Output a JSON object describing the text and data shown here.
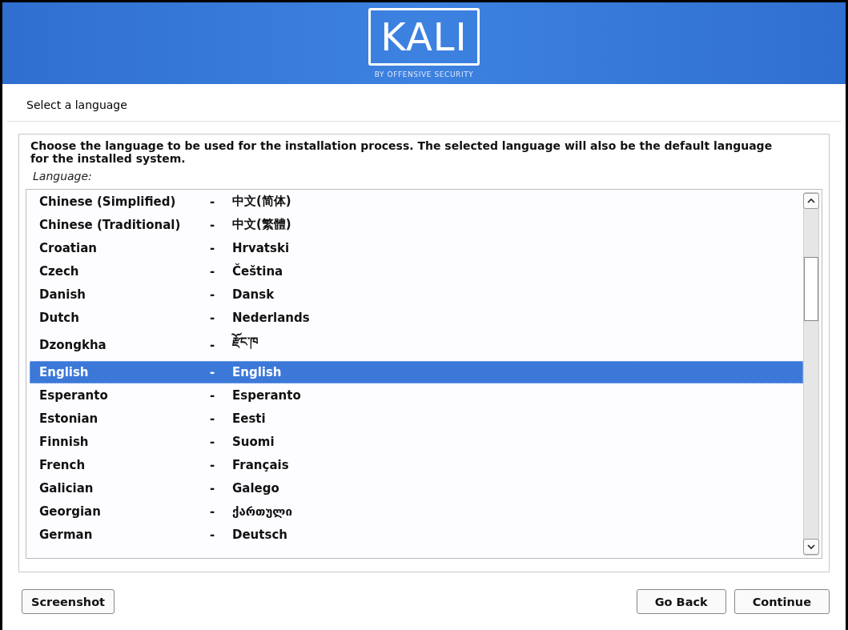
{
  "header": {
    "logo_text": "KALI",
    "logo_tagline": "BY OFFENSIVE SECURITY"
  },
  "page_title": "Select a language",
  "description": "Choose the language to be used for the installation process. The selected language will also be the default language for the installed system.",
  "list_label": "Language:",
  "languages": [
    {
      "name": "Chinese (Simplified)",
      "separator": "-",
      "native": "中文(简体)",
      "selected": false
    },
    {
      "name": "Chinese (Traditional)",
      "separator": "-",
      "native": "中文(繁體)",
      "selected": false
    },
    {
      "name": "Croatian",
      "separator": "-",
      "native": "Hrvatski",
      "selected": false
    },
    {
      "name": "Czech",
      "separator": "-",
      "native": "Čeština",
      "selected": false
    },
    {
      "name": "Danish",
      "separator": "-",
      "native": "Dansk",
      "selected": false
    },
    {
      "name": "Dutch",
      "separator": "-",
      "native": "Nederlands",
      "selected": false
    },
    {
      "name": "Dzongkha",
      "separator": "-",
      "native": "རྫོང་ཁ",
      "selected": false
    },
    {
      "name": "English",
      "separator": "-",
      "native": "English",
      "selected": true
    },
    {
      "name": "Esperanto",
      "separator": "-",
      "native": "Esperanto",
      "selected": false
    },
    {
      "name": "Estonian",
      "separator": "-",
      "native": "Eesti",
      "selected": false
    },
    {
      "name": "Finnish",
      "separator": "-",
      "native": "Suomi",
      "selected": false
    },
    {
      "name": "French",
      "separator": "-",
      "native": "Français",
      "selected": false
    },
    {
      "name": "Galician",
      "separator": "-",
      "native": "Galego",
      "selected": false
    },
    {
      "name": "Georgian",
      "separator": "-",
      "native": "ქართული",
      "selected": false
    },
    {
      "name": "German",
      "separator": "-",
      "native": "Deutsch",
      "selected": false
    }
  ],
  "buttons": {
    "left": [
      {
        "label": "Screenshot"
      }
    ],
    "right": [
      {
        "label": "Go Back"
      },
      {
        "label": "Continue"
      }
    ]
  }
}
